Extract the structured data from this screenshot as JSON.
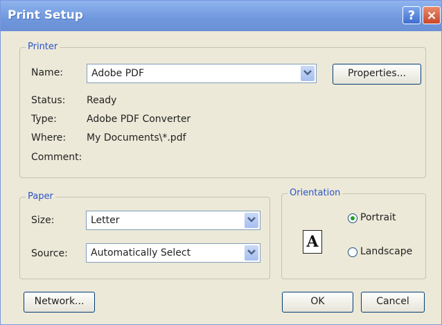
{
  "window": {
    "title": "Print Setup",
    "help_label": "?",
    "close_label": "×"
  },
  "printer": {
    "legend": "Printer",
    "name_label": "Name:",
    "name_value": "Adobe PDF",
    "properties_label": "Properties...",
    "status_label": "Status:",
    "status_value": "Ready",
    "type_label": "Type:",
    "type_value": "Adobe PDF Converter",
    "where_label": "Where:",
    "where_value": "My Documents\\*.pdf",
    "comment_label": "Comment:",
    "comment_value": ""
  },
  "paper": {
    "legend": "Paper",
    "size_label": "Size:",
    "size_value": "Letter",
    "source_label": "Source:",
    "source_value": "Automatically Select"
  },
  "orientation": {
    "legend": "Orientation",
    "page_glyph": "A",
    "portrait_label": "Portrait",
    "landscape_label": "Landscape",
    "selected": "Portrait"
  },
  "buttons": {
    "network": "Network...",
    "ok": "OK",
    "cancel": "Cancel"
  },
  "colors": {
    "title_bar": "#6f97dc",
    "dialog_bg": "#ece9d8",
    "group_title": "#2a53c8"
  }
}
